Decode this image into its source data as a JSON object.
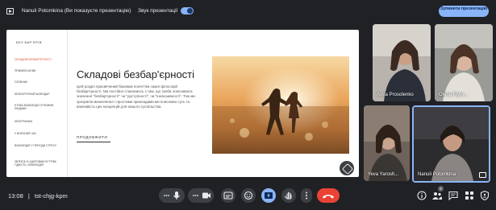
{
  "topbar": {
    "presenter_label": "Nanuli Potomkina (Ви показуєте презентацію)",
    "sound_label": "Звук презентації",
    "sound_on": true,
    "stop_button": "Зупинити презентацію"
  },
  "slide": {
    "sidebar_title": "БЕЗ БАР'ЄРІВ",
    "menu": [
      {
        "label": "СКЛАДОВІ БЕЗБАР'ЄРНОСТІ",
        "active": true
      },
      {
        "label": "ПРАВИЛА МОВИ",
        "active": false
      },
      {
        "label": "СЛОВНИК",
        "active": false
      },
      {
        "label": "БЕЗБАР'ЄРНИЙ КАЛЕНДАР",
        "active": false
      },
      {
        "label": "ЕТИКА ВЗАЄМОДІЇ З РІЗНИМИ ЛЮДЬМИ",
        "active": false
      },
      {
        "label": "ІНФОГРАФІКИ",
        "active": false
      },
      {
        "label": "У ВОЄННИЙ ЧАС",
        "active": false
      },
      {
        "label": "ВЗАЄМОДІЯ У ПЕРІОДИ СТРЕСУ",
        "active": false
      },
      {
        "label": "ЗВ'ЯЗОК ЗІ ЗДОРОВИМ БУТТЯМ: ГІДНІСТЬ, ВЗАЄМОДІЯ",
        "active": false
      }
    ],
    "title": "Складові безбар'єрності",
    "text": "Цей розділ присвячений базовим поняттям самої філософії безбар'єрності. Ми постійно стикаємось з тим, що треба пояснювати значення \"безбар'єрності\" чи \"доступності\", чи \"інклюзивності\". Тож ми зрозуміли визначення і простими прикладами ми пояснимо суть та важливість цих концепцій для нашого суспільства.",
    "more_link": "ПРОДОВЖИТИ"
  },
  "participants": [
    {
      "name": "Anna Prosolenko"
    },
    {
      "name": "Olena Klym..."
    },
    {
      "name": "Yeva Yarosh..."
    },
    {
      "name": "Nanuli Potomkina"
    }
  ],
  "bottombar": {
    "time": "13:08",
    "separator": "|",
    "meeting_code": "tst-chjg-kpm",
    "people_count": "4"
  },
  "colors": {
    "accent": "#8ab4f8",
    "end_call": "#ea4335",
    "active_menu": "#d94a2b",
    "background": "#202124"
  }
}
